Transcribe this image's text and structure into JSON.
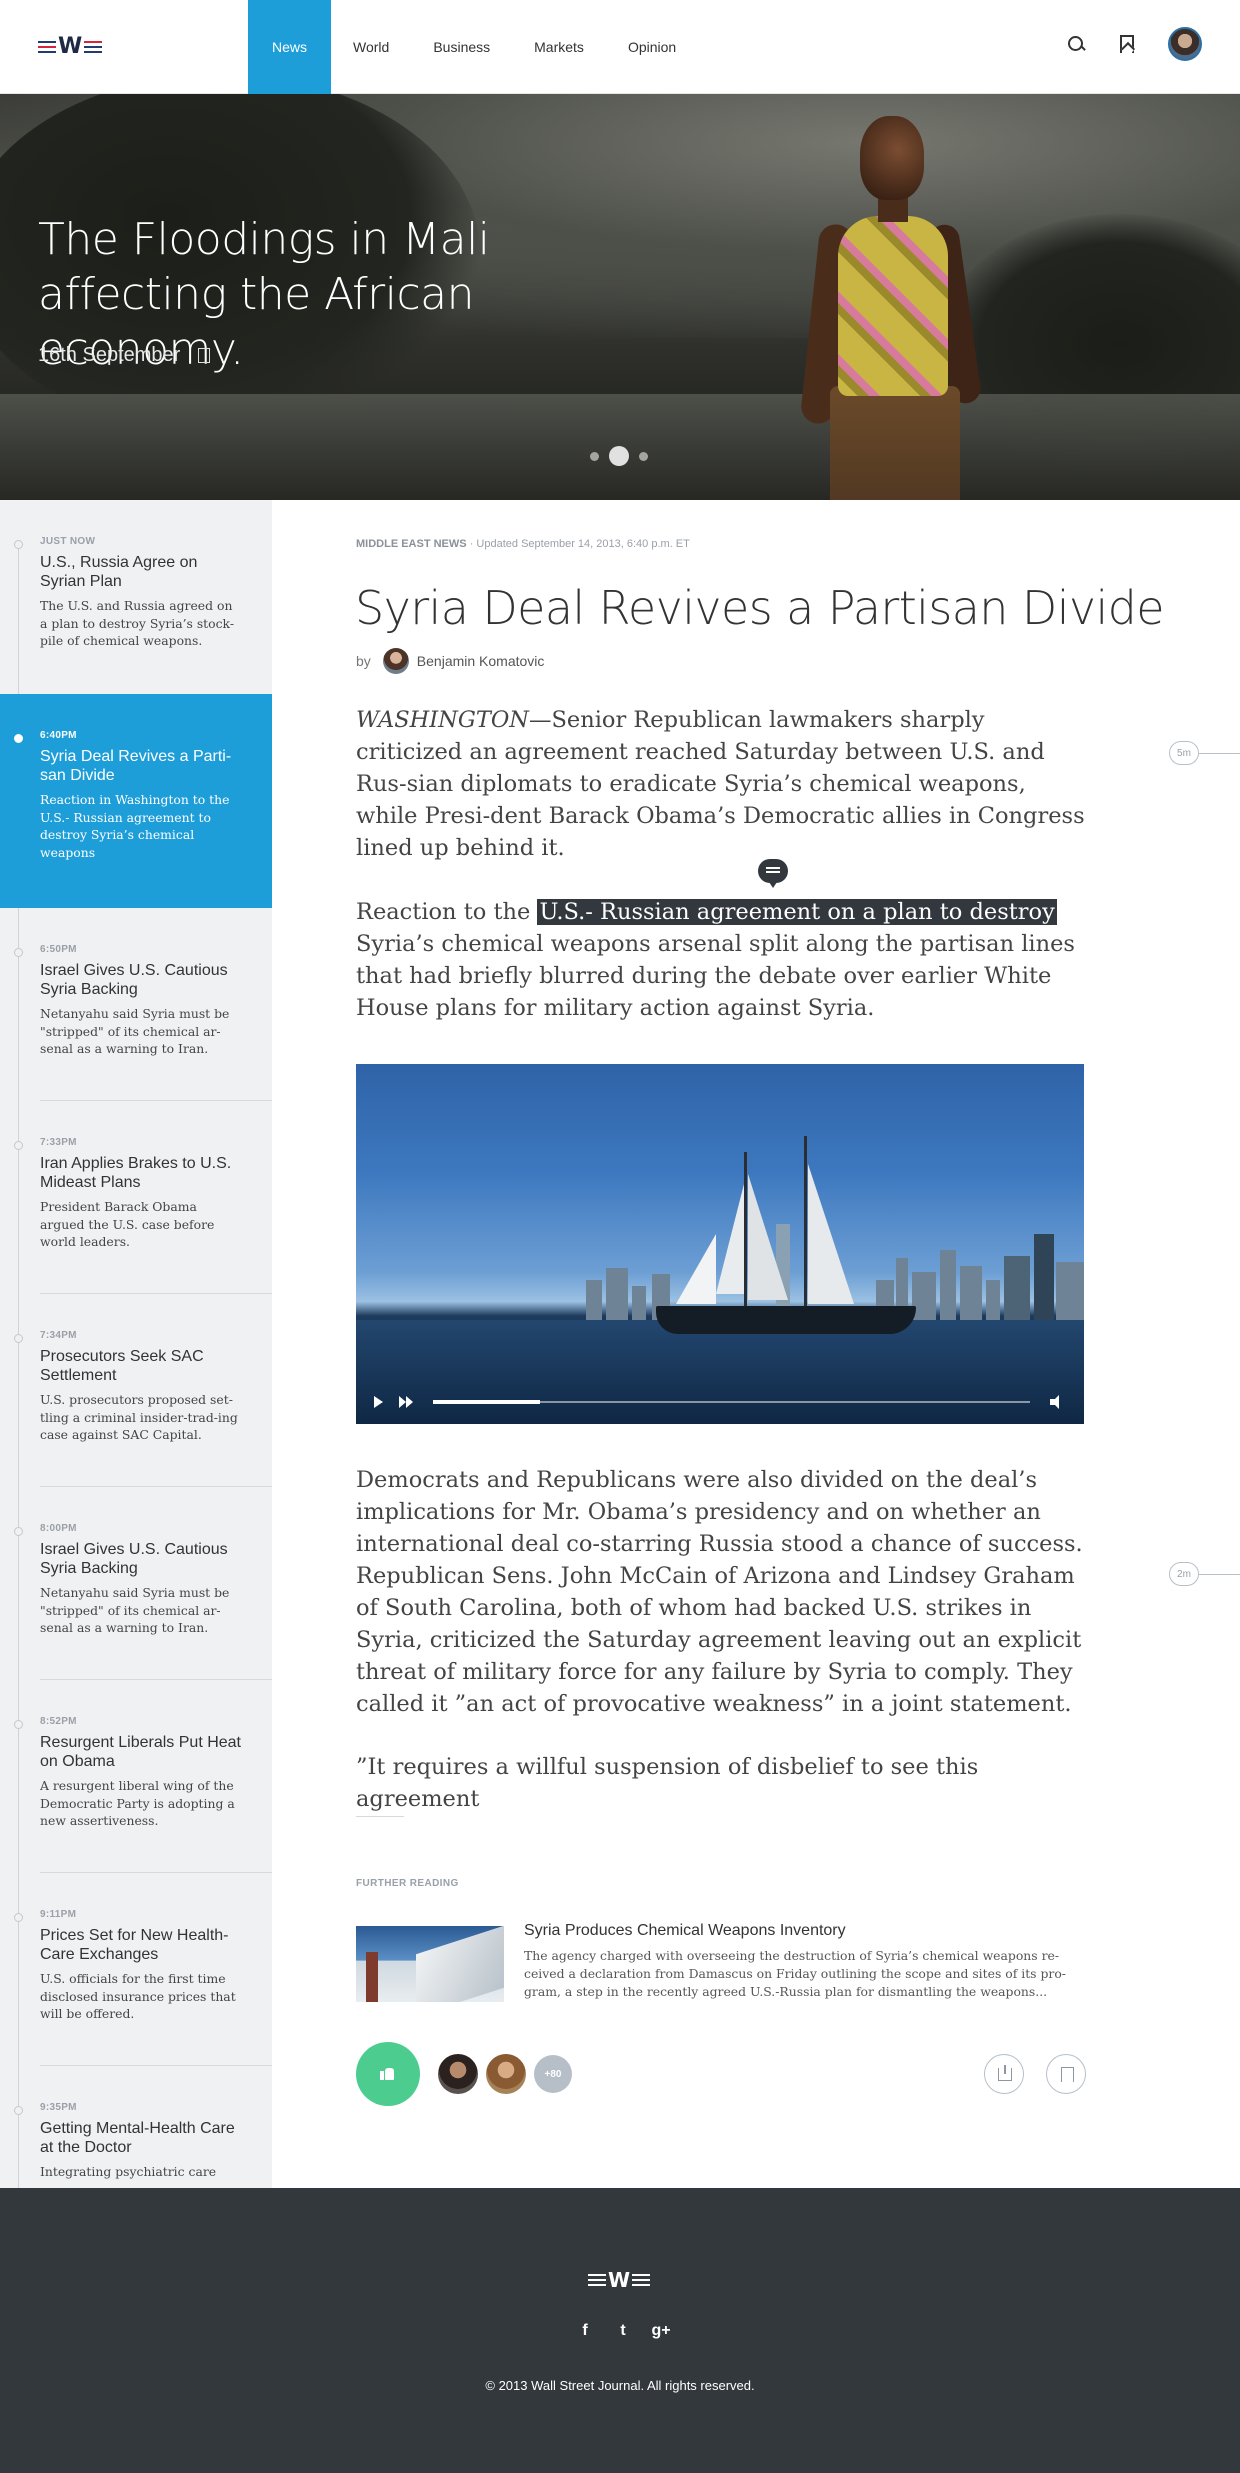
{
  "nav": {
    "logo_letter": "W",
    "tabs": [
      {
        "label": "News",
        "active": true
      },
      {
        "label": "World",
        "active": false
      },
      {
        "label": "Business",
        "active": false
      },
      {
        "label": "Markets",
        "active": false
      },
      {
        "label": "Opinion",
        "active": false
      }
    ],
    "icons": [
      "search-icon",
      "bookmark-icon",
      "avatar"
    ],
    "accent_color": "#1d9ed9"
  },
  "hero": {
    "title": "The Floodings in Mali affecting the African economy.",
    "date": "16th September",
    "slides": 3,
    "active_slide": 2
  },
  "sidebar": {
    "items": [
      {
        "time": "Just now",
        "headline": "U.S., Russia Agree on Syrian Plan",
        "summary": "The U.S. and Russia agreed on a plan to destroy Syria’s stock-pile of chemical weapons."
      },
      {
        "time": "6:40PM",
        "headline": "Syria Deal Revives a Parti-san Divide",
        "summary": "Reaction in Washington to the U.S.- Russian agreement to destroy Syria’s chemical weapons",
        "active": true
      },
      {
        "time": "6:50PM",
        "headline": "Israel Gives U.S. Cautious Syria Backing",
        "summary": "Netanyahu said Syria must be \"stripped\" of its chemical ar-senal as a warning to Iran."
      },
      {
        "time": "7:33PM",
        "headline": "Iran Applies Brakes to U.S. Mideast Plans",
        "summary": "President Barack Obama argued the U.S. case before world leaders."
      },
      {
        "time": "7:34PM",
        "headline": "Prosecutors Seek SAC Settlement",
        "summary": "U.S. prosecutors proposed set-tling a criminal insider-trad-ing case against SAC Capital."
      },
      {
        "time": "8:00PM",
        "headline": "Israel Gives U.S. Cautious Syria Backing",
        "summary": "Netanyahu said Syria must be \"stripped\" of its chemical ar-senal as a warning to Iran."
      },
      {
        "time": "8:52PM",
        "headline": "Resurgent Liberals Put Heat on Obama",
        "summary": "A resurgent liberal wing of the Democratic Party is adopting a new assertiveness."
      },
      {
        "time": "9:11PM",
        "headline": "Prices Set for New Health-Care Exchanges",
        "summary": "U.S. officials for the first time disclosed insurance prices that will be offered."
      },
      {
        "time": "9:35PM",
        "headline": "Getting Mental-Health Care at the Doctor",
        "summary": "Integrating psychiatric care"
      }
    ]
  },
  "article": {
    "section": "Middle East News",
    "separator": "·",
    "updated": "Updated September 14, 2013, 6:40 p.m. ET",
    "title": "Syria Deal Revives a Partisan Divide",
    "by_label": "by",
    "author": "Benjamin Komatovic",
    "p1_dateline": "WASHINGTON",
    "p1_text": "—Senior Republican lawmakers sharply criticized an agreement reached Saturday between U.S. and Rus-sian diplomats to eradicate Syria’s chemical weapons, while Presi-dent Barack Obama’s Democratic allies in Congress lined up behind it.",
    "p2_before": "Reaction to the ",
    "p2_highlight": "U.S.- Russian agreement on a plan to destroy",
    "p2_after": " Syria’s chemical weapons arsenal split along the partisan lines that had briefly blurred during the debate over earlier White House plans for military action against Syria.",
    "p3": "Democrats and Republicans were also divided on the deal’s implications for Mr. Obama’s presidency and on whether an international deal co-starring Russia stood a chance of success. Republican Sens. John McCain of Arizona and Lindsey Graham of South Carolina, both of whom had backed U.S. strikes in Syria, criticized the Saturday agreement leaving out an explicit threat of military force for any failure by Syria to comply. They called it ”an act of provocative weakness” in a joint statement.",
    "p4": "”It requires a willful suspension of disbelief to see this agreement",
    "reading_markers": [
      "5m",
      "2m"
    ],
    "video": {
      "progress": 0.18
    }
  },
  "further_reading": {
    "label": "Further reading",
    "title": "Syria Produces Chemical Weapons Inventory",
    "summary": "The agency charged with overseeing the destruction of Syria’s chemical weapons re-ceived a declaration from Damascus on Friday outlining the scope and sites of its pro-gram, a step in the recently agreed U.S.-Russia plan for dismantling the weapons..."
  },
  "actions": {
    "like_color": "#4ccd8f",
    "more_count": "+80"
  },
  "footer": {
    "logo_letter": "W",
    "socials": [
      "f",
      "t",
      "g+"
    ],
    "copyright": "© 2013 Wall Street Journal. All rights reserved."
  }
}
